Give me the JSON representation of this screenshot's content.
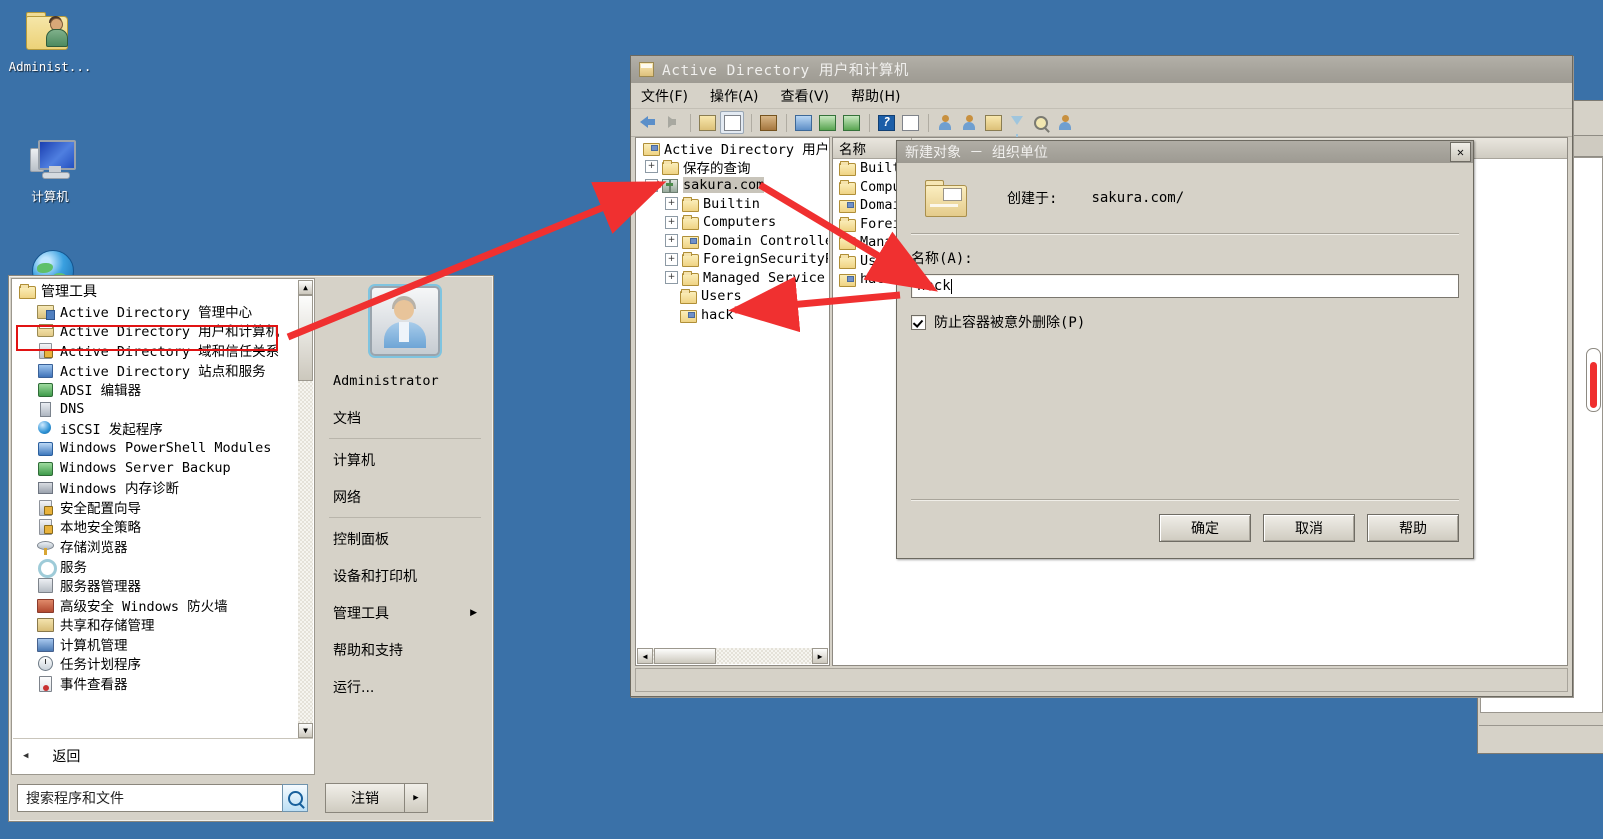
{
  "desktop": {
    "icons": [
      {
        "name": "Administ...",
        "icon": "user-folder-icon"
      },
      {
        "name": "计算机",
        "icon": "computer-icon"
      },
      {
        "name": "",
        "icon": "network-globe-icon"
      }
    ],
    "background_color": "#3a71a8"
  },
  "start_menu": {
    "group_label": "管理工具",
    "group_icon": "folder-icon",
    "programs": [
      {
        "label": "Active Directory 管理中心",
        "icon": "ad-admin-center-icon"
      },
      {
        "label": "Active Directory 用户和计算机",
        "icon": "ad-users-computers-icon",
        "highlighted": true
      },
      {
        "label": "Active Directory 域和信任关系",
        "icon": "ad-domains-trusts-icon"
      },
      {
        "label": "Active Directory 站点和服务",
        "icon": "ad-sites-services-icon"
      },
      {
        "label": "ADSI 编辑器",
        "icon": "adsi-edit-icon"
      },
      {
        "label": "DNS",
        "icon": "dns-icon"
      },
      {
        "label": "iSCSI 发起程序",
        "icon": "iscsi-icon"
      },
      {
        "label": "Windows PowerShell Modules",
        "icon": "powershell-icon"
      },
      {
        "label": "Windows Server Backup",
        "icon": "server-backup-icon"
      },
      {
        "label": "Windows 内存诊断",
        "icon": "memory-diagnostic-icon"
      },
      {
        "label": "安全配置向导",
        "icon": "security-wizard-icon"
      },
      {
        "label": "本地安全策略",
        "icon": "local-security-policy-icon"
      },
      {
        "label": "存储浏览器",
        "icon": "storage-explorer-icon"
      },
      {
        "label": "服务",
        "icon": "services-icon"
      },
      {
        "label": "服务器管理器",
        "icon": "server-manager-icon"
      },
      {
        "label": "高级安全 Windows 防火墙",
        "icon": "firewall-icon"
      },
      {
        "label": "共享和存储管理",
        "icon": "share-storage-icon"
      },
      {
        "label": "计算机管理",
        "icon": "computer-management-icon"
      },
      {
        "label": "任务计划程序",
        "icon": "task-scheduler-icon"
      },
      {
        "label": "事件查看器",
        "icon": "event-viewer-icon"
      }
    ],
    "back_label": "返回",
    "back_icon": "chevron-left-icon",
    "user": {
      "name": "Administrator",
      "avatar": "user-avatar"
    },
    "right_items": [
      {
        "label": "文档"
      },
      {
        "label": "计算机"
      },
      {
        "label": "网络"
      },
      {
        "label": "控制面板"
      },
      {
        "label": "设备和打印机"
      },
      {
        "label": "管理工具",
        "submenu": "▶"
      },
      {
        "label": "帮助和支持"
      },
      {
        "label": "运行..."
      }
    ],
    "search": {
      "placeholder": "搜索程序和文件",
      "value": "搜索程序和文件",
      "icon": "search-icon"
    },
    "logoff": {
      "label": "注销",
      "arrow": "▶"
    }
  },
  "aduc_window": {
    "title": "Active Directory 用户和计算机",
    "title_icon": "console-icon",
    "menus": [
      "文件(F)",
      "操作(A)",
      "查看(V)",
      "帮助(H)"
    ],
    "toolbar_icons": [
      "back-arrow-icon",
      "forward-arrow-icon",
      "up-folder-icon",
      "show-tree-icon",
      "properties-icon",
      "list-view-icon",
      "refresh-icon",
      "export-list-icon",
      "help-icon",
      "console-view-icon",
      "new-user-icon",
      "new-group-icon",
      "new-ou-icon",
      "filter-icon",
      "find-icon",
      "saved-query-icon"
    ],
    "tree": [
      {
        "label": "Active Directory 用户:",
        "icon": "console-root-icon",
        "indent": 0,
        "expander": ""
      },
      {
        "label": "保存的查询",
        "icon": "folder-icon",
        "indent": 1,
        "expander": "+"
      },
      {
        "label": "sakura.com",
        "icon": "domain-icon",
        "indent": 1,
        "expander": "−",
        "selected": true
      },
      {
        "label": "Builtin",
        "icon": "folder-icon",
        "indent": 2,
        "expander": "+"
      },
      {
        "label": "Computers",
        "icon": "folder-icon",
        "indent": 2,
        "expander": "+"
      },
      {
        "label": "Domain Controller",
        "icon": "ou-icon",
        "indent": 2,
        "expander": "+"
      },
      {
        "label": "ForeignSecurityP:",
        "icon": "folder-icon",
        "indent": 2,
        "expander": "+"
      },
      {
        "label": "Managed Service",
        "icon": "folder-icon",
        "indent": 2,
        "expander": "+"
      },
      {
        "label": "Users",
        "icon": "folder-icon",
        "indent": 2,
        "expander": ""
      },
      {
        "label": "hack",
        "icon": "ou-icon",
        "indent": 2,
        "expander": ""
      }
    ],
    "list_column_header": "名称",
    "list_items": [
      {
        "label": "Builti",
        "icon": "folder-icon"
      },
      {
        "label": "Comput",
        "icon": "folder-icon"
      },
      {
        "label": "Domain",
        "icon": "ou-icon"
      },
      {
        "label": "Foreig",
        "icon": "folder-icon"
      },
      {
        "label": "Manage",
        "icon": "folder-icon"
      },
      {
        "label": "Users",
        "icon": "folder-icon"
      },
      {
        "label": "hack",
        "icon": "ou-icon"
      }
    ]
  },
  "dialog": {
    "title": "新建对象 － 组织单位",
    "close_label": "✕",
    "icon": "ou-folder-icon",
    "created_in_label": "创建于:",
    "created_in_value": "sakura.com/",
    "name_label": "名称(A):",
    "name_value": "hack",
    "protect_checkbox_label": "防止容器被意外删除(P)",
    "protect_checked": true,
    "buttons": [
      {
        "label": "确定",
        "name": "ok"
      },
      {
        "label": "取消",
        "name": "cancel"
      },
      {
        "label": "帮助",
        "name": "help"
      }
    ]
  },
  "annotations": {
    "highlight_color": "#e11313",
    "arrows": [
      {
        "from": "start-menu-ad-users-computers",
        "to": "tree-sakura-com"
      },
      {
        "from": "tree-sakura-com",
        "to": "dialog-name-field"
      },
      {
        "from": "list-hack",
        "to": "tree-hack"
      }
    ]
  }
}
